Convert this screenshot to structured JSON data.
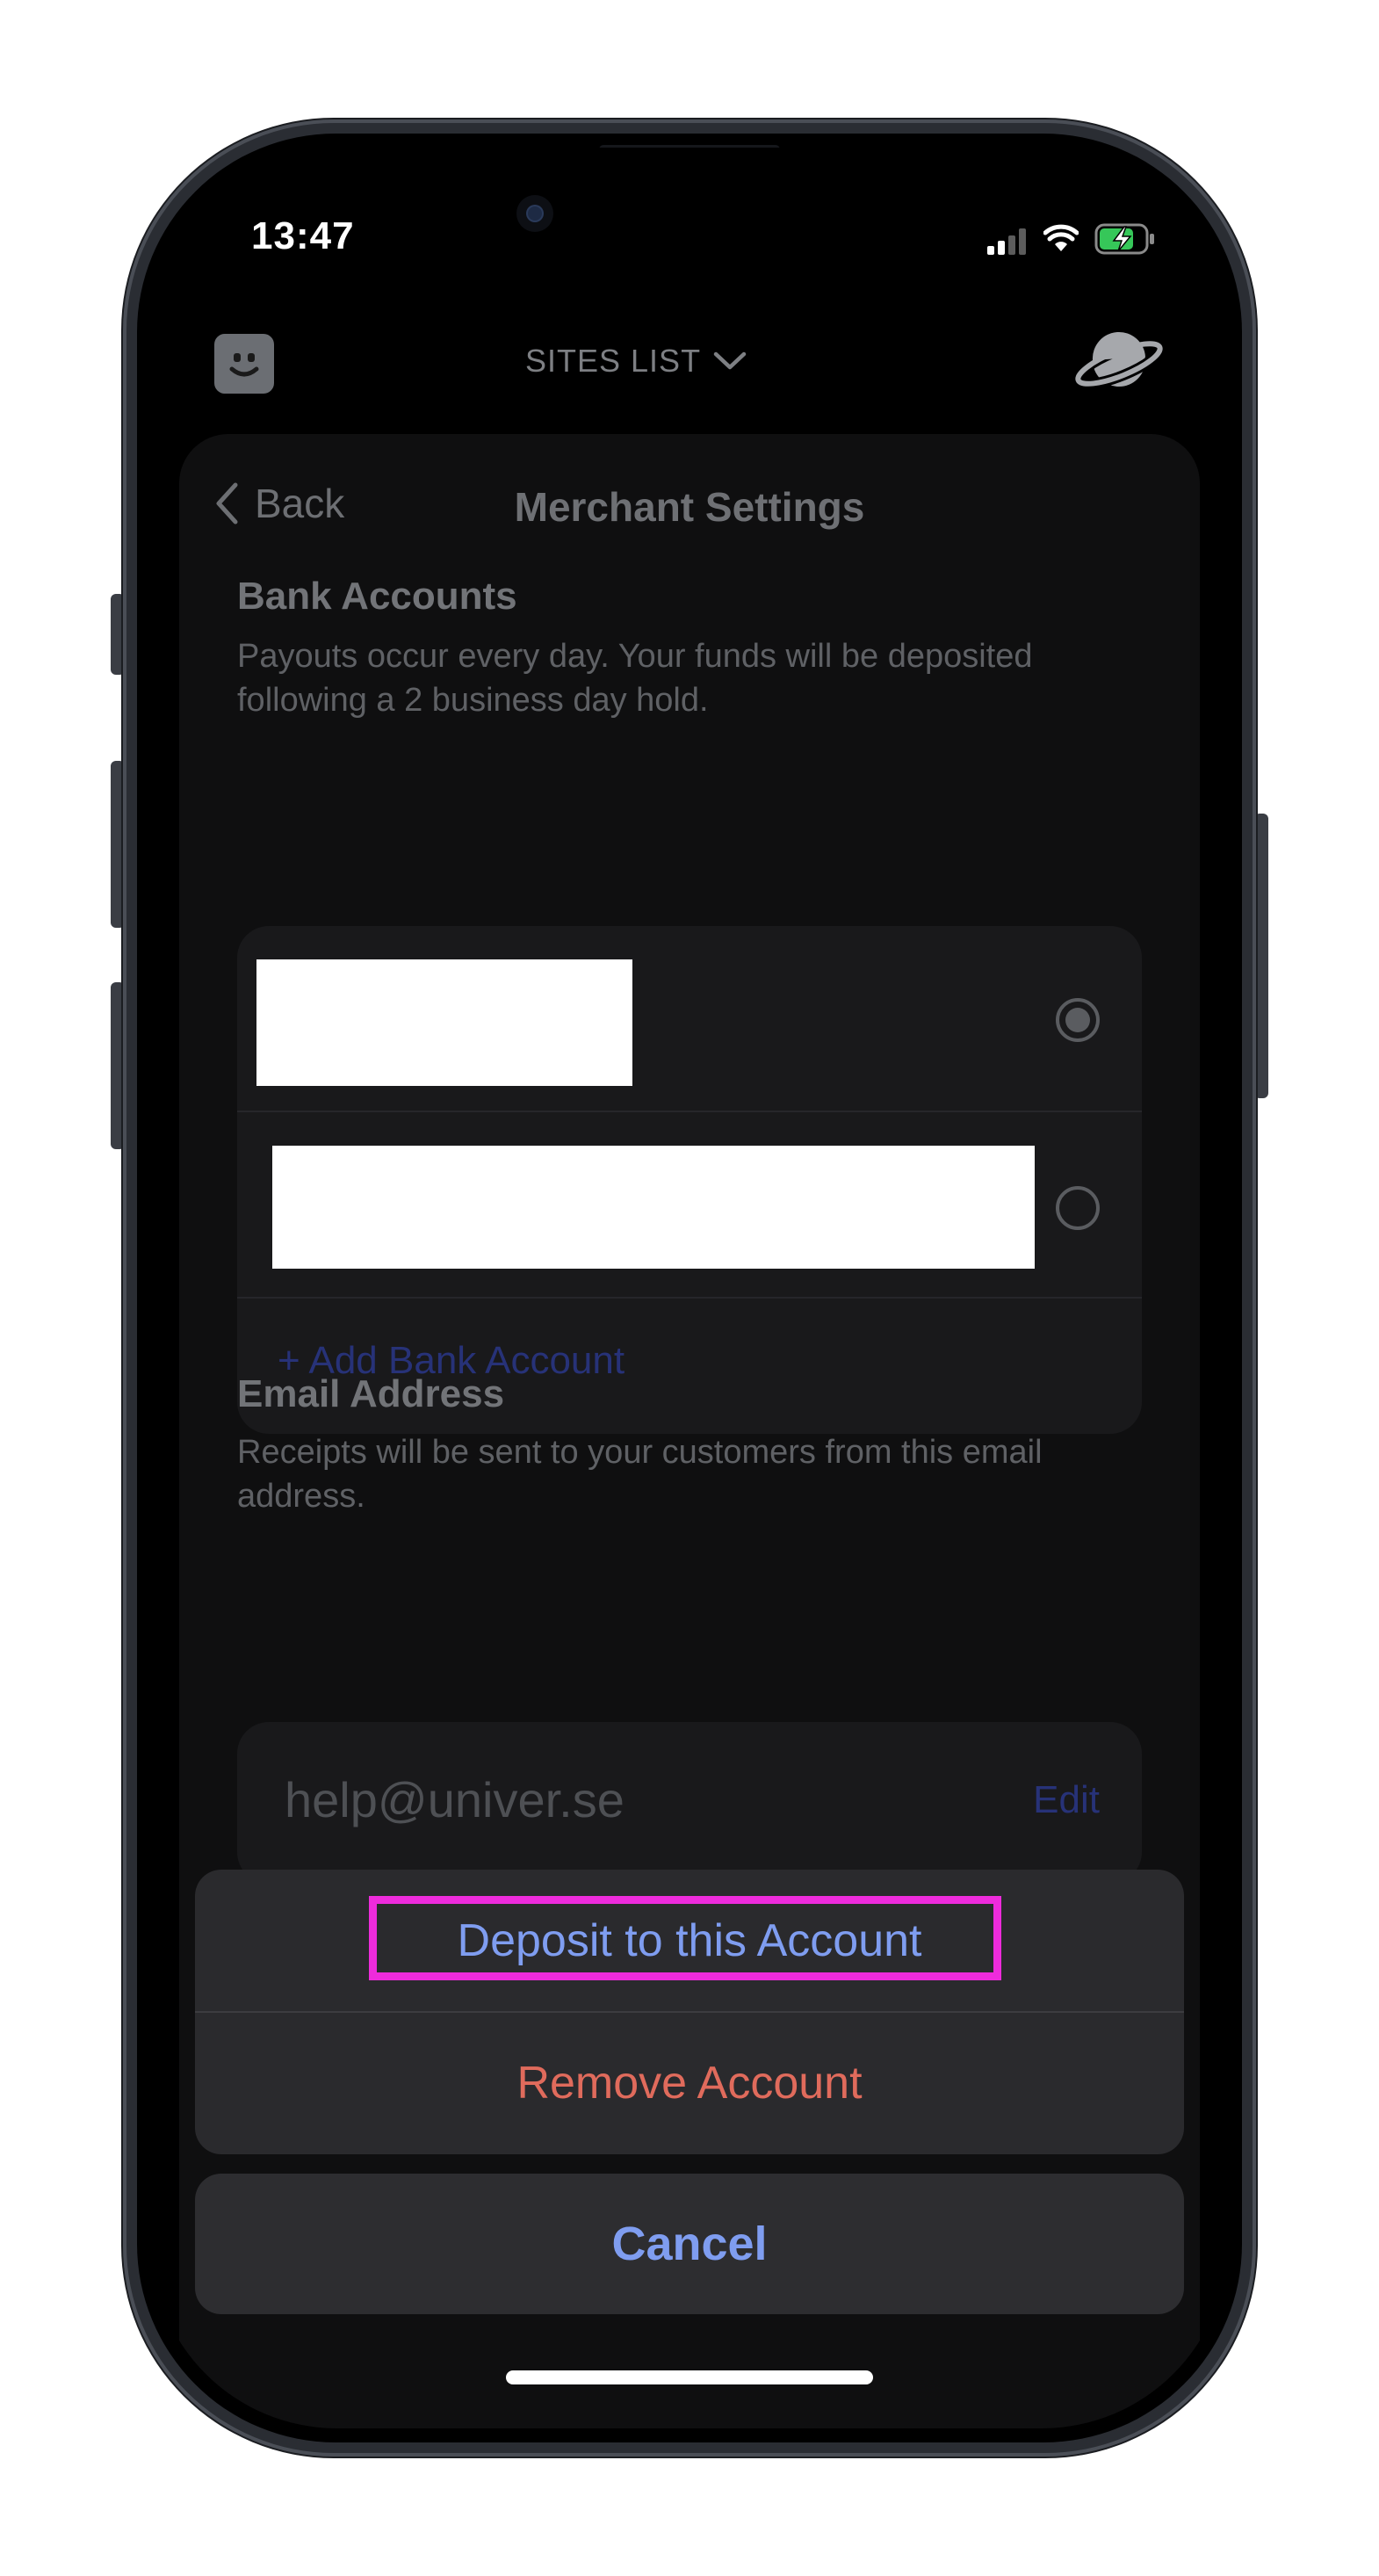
{
  "status_bar": {
    "time": "13:47"
  },
  "app_bar": {
    "sites_label": "SITES LIST",
    "left_icon": "face-icon",
    "right_icon": "planet-icon"
  },
  "sheet": {
    "back_label": "Back",
    "title": "Merchant Settings"
  },
  "bank_accounts": {
    "title": "Bank Accounts",
    "description": "Payouts occur every day. Your funds will be deposited following a 2 business day hold.",
    "accounts": [
      {
        "name": "",
        "selected": true
      },
      {
        "name": "",
        "selected": false
      }
    ],
    "add_label": "+ Add Bank Account"
  },
  "email": {
    "title": "Email Address",
    "description": "Receipts will be sent to your customers from this email address.",
    "value": "help@univer.se",
    "edit_label": "Edit"
  },
  "action_sheet": {
    "deposit_label": "Deposit to this Account",
    "remove_label": "Remove Account",
    "cancel_label": "Cancel"
  },
  "colors": {
    "action_blue": "#7f9df0",
    "destructive_red": "#e06b5c",
    "link_blue": "#273278",
    "highlight": "#ee2bdc"
  }
}
